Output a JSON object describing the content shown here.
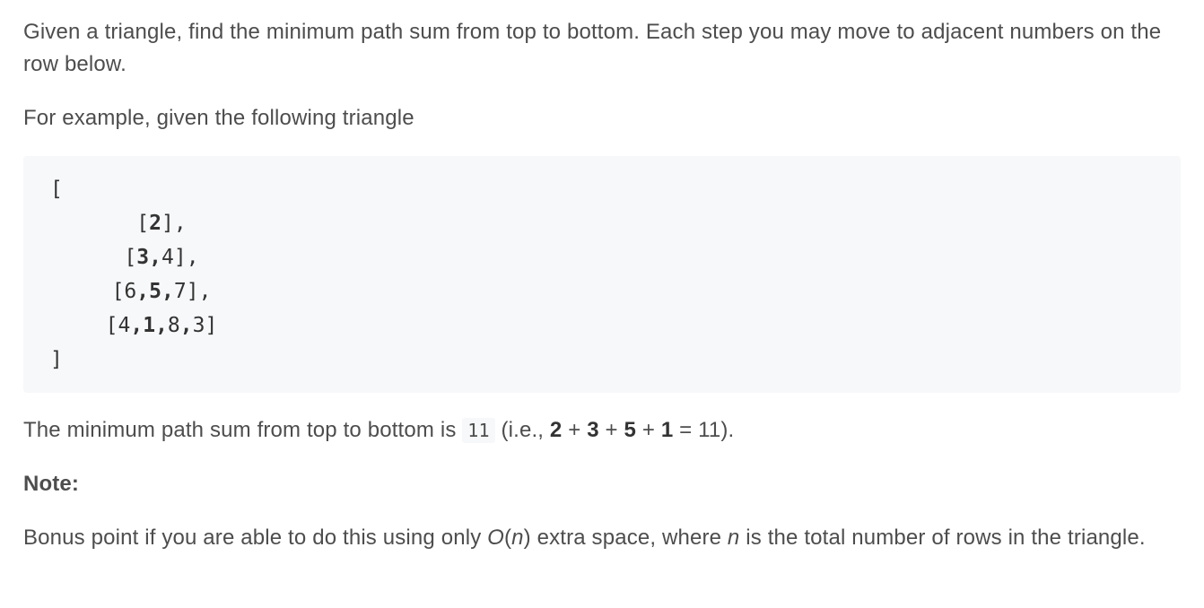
{
  "intro": {
    "text": "Given a triangle, find the minimum path sum from top to bottom. Each step you may move to adjacent numbers on the row below."
  },
  "example": {
    "text": "For example, given the following triangle"
  },
  "code": {
    "open_bracket": "[",
    "close_bracket": "]",
    "rows": [
      {
        "prefix": "[",
        "cells": [
          {
            "value": "2",
            "bold": true
          }
        ],
        "suffix": "],"
      },
      {
        "prefix": "[",
        "cells": [
          {
            "value": "3",
            "bold": true
          },
          {
            "value": "4",
            "bold": false
          }
        ],
        "suffix": "],"
      },
      {
        "prefix": "[",
        "cells": [
          {
            "value": "6",
            "bold": false
          },
          {
            "value": "5",
            "bold": true
          },
          {
            "value": "7",
            "bold": false
          }
        ],
        "suffix": "],"
      },
      {
        "prefix": "[",
        "cells": [
          {
            "value": "4",
            "bold": false
          },
          {
            "value": "1",
            "bold": true
          },
          {
            "value": "8",
            "bold": false
          },
          {
            "value": "3",
            "bold": false
          }
        ],
        "suffix": "]"
      }
    ]
  },
  "answer": {
    "prefix": "The minimum path sum from top to bottom is ",
    "code_value": "11",
    "paren_open": " (i.e., ",
    "terms": [
      "2",
      "3",
      "5",
      "1"
    ],
    "plus": " + ",
    "equals": " = 11)."
  },
  "note": {
    "label": "Note:"
  },
  "bonus": {
    "part1": "Bonus point if you are able to do this using only ",
    "o_letter": "O",
    "paren_l": "(",
    "n1": "n",
    "paren_r": ")",
    "part2": " extra space, where ",
    "n2": "n",
    "part3": " is the total number of rows in the triangle."
  }
}
